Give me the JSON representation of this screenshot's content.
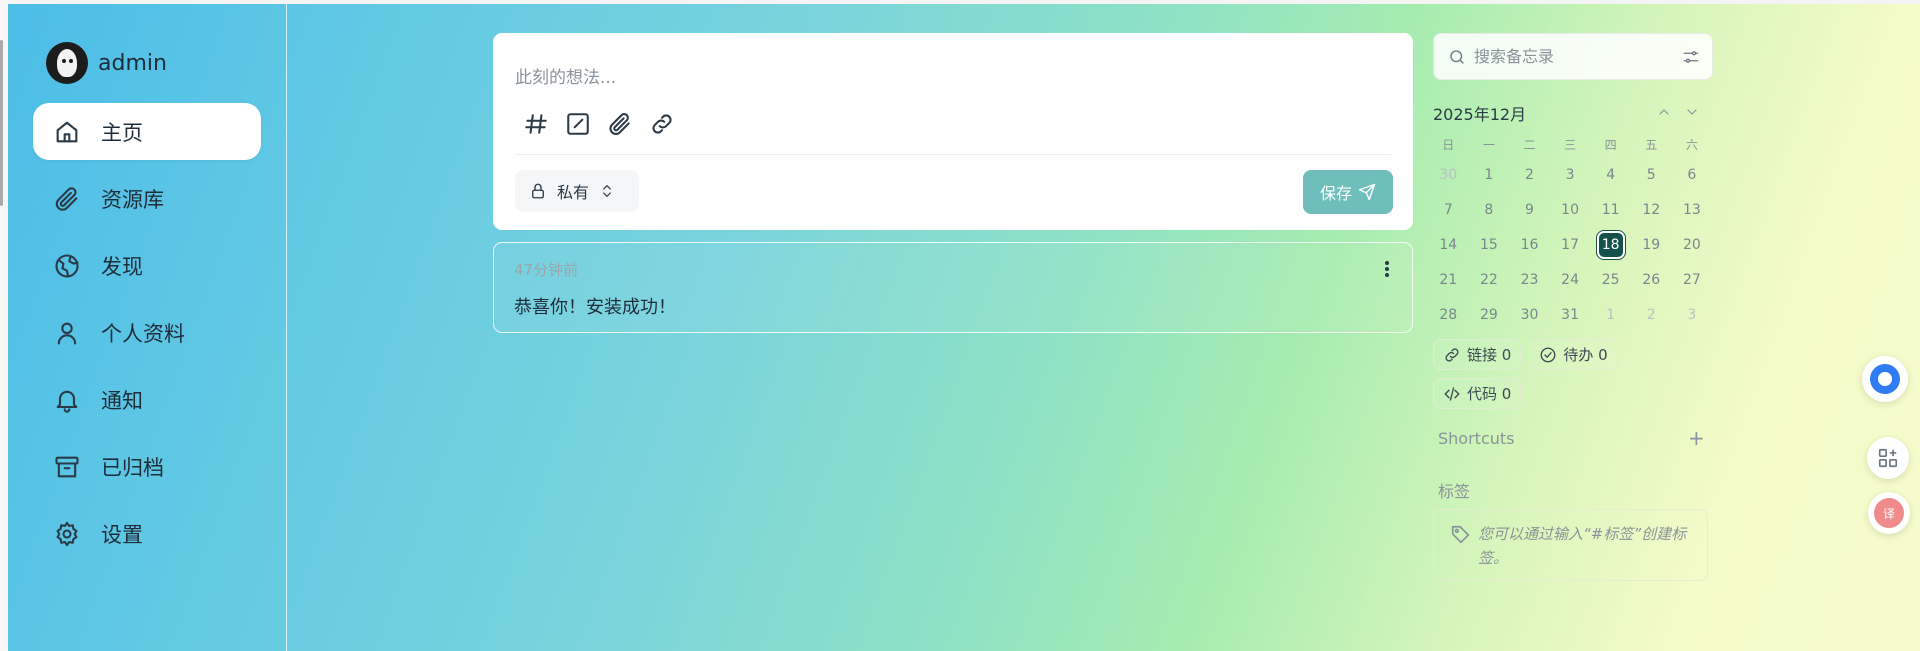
{
  "user": {
    "name": "admin"
  },
  "nav": [
    {
      "label": "主页",
      "icon": "home-icon",
      "active": true
    },
    {
      "label": "资源库",
      "icon": "paperclip-icon"
    },
    {
      "label": "发现",
      "icon": "globe-icon"
    },
    {
      "label": "个人资料",
      "icon": "user-icon"
    },
    {
      "label": "通知",
      "icon": "bell-icon"
    },
    {
      "label": "已归档",
      "icon": "archive-icon"
    },
    {
      "label": "设置",
      "icon": "gear-icon"
    }
  ],
  "editor": {
    "placeholder": "此刻的想法...",
    "visibility": "私有",
    "save_label": "保存"
  },
  "memo": {
    "time": "47分钟前",
    "content": "恭喜你！安装成功！"
  },
  "search": {
    "placeholder": "搜索备忘录"
  },
  "calendar": {
    "title": "2025年12月",
    "weekdays": [
      "日",
      "一",
      "二",
      "三",
      "四",
      "五",
      "六"
    ],
    "weeks": [
      [
        "30",
        "1",
        "2",
        "3",
        "4",
        "5",
        "6"
      ],
      [
        "7",
        "8",
        "9",
        "10",
        "11",
        "12",
        "13"
      ],
      [
        "14",
        "15",
        "16",
        "17",
        "18",
        "19",
        "20"
      ],
      [
        "21",
        "22",
        "23",
        "24",
        "25",
        "26",
        "27"
      ],
      [
        "28",
        "29",
        "30",
        "31",
        "1",
        "2",
        "3"
      ]
    ],
    "today": "18"
  },
  "stats": {
    "links": "链接 0",
    "todo": "待办 0",
    "code": "代码 0"
  },
  "shortcuts": {
    "title": "Shortcuts",
    "add": "+"
  },
  "tags": {
    "title": "标签",
    "hint": "您可以通过输入“#标签”创建标签。"
  },
  "colors": {
    "accent": "#6ebebb",
    "today_bg": "#15514b",
    "floating_blue": "#2f7cf3"
  }
}
